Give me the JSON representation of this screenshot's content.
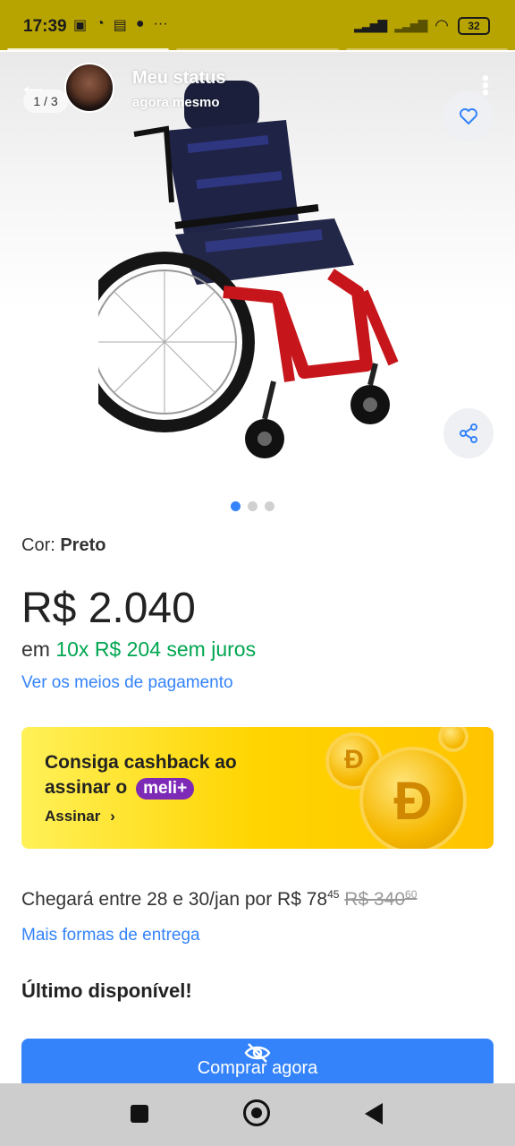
{
  "status_bar": {
    "time": "17:39",
    "battery": "32"
  },
  "story": {
    "title": "Meu status",
    "subtitle": "agora mesmo",
    "counter": "1 / 3"
  },
  "product": {
    "color_label": "Cor: ",
    "color_value": "Preto",
    "price": "R$ 2.040",
    "install_prefix": "em ",
    "install_value": "10x R$ 204 sem juros",
    "payment_link": "Ver os meios de pagamento"
  },
  "banner": {
    "line1": "Consiga cashback ao",
    "line2": "assinar o",
    "badge": "meli+",
    "cta": "Assinar",
    "chevron": "›"
  },
  "delivery": {
    "prefix": "Chegará entre 28 e 30/jan por ",
    "price_int": "R$ 78",
    "price_cents": "45",
    "old_price_int": "R$ 340",
    "old_price_cents": "60",
    "more_link": "Mais formas de entrega"
  },
  "stock": "Último disponível!",
  "buy_button": "Comprar agora",
  "gallery": {
    "total_images": 3,
    "active_index": 0
  },
  "colors": {
    "accent": "#3483fa",
    "green": "#00a650",
    "status_bar": "#b8a400",
    "banner": "#ffd400",
    "meli_purple": "#7d2ab7"
  }
}
